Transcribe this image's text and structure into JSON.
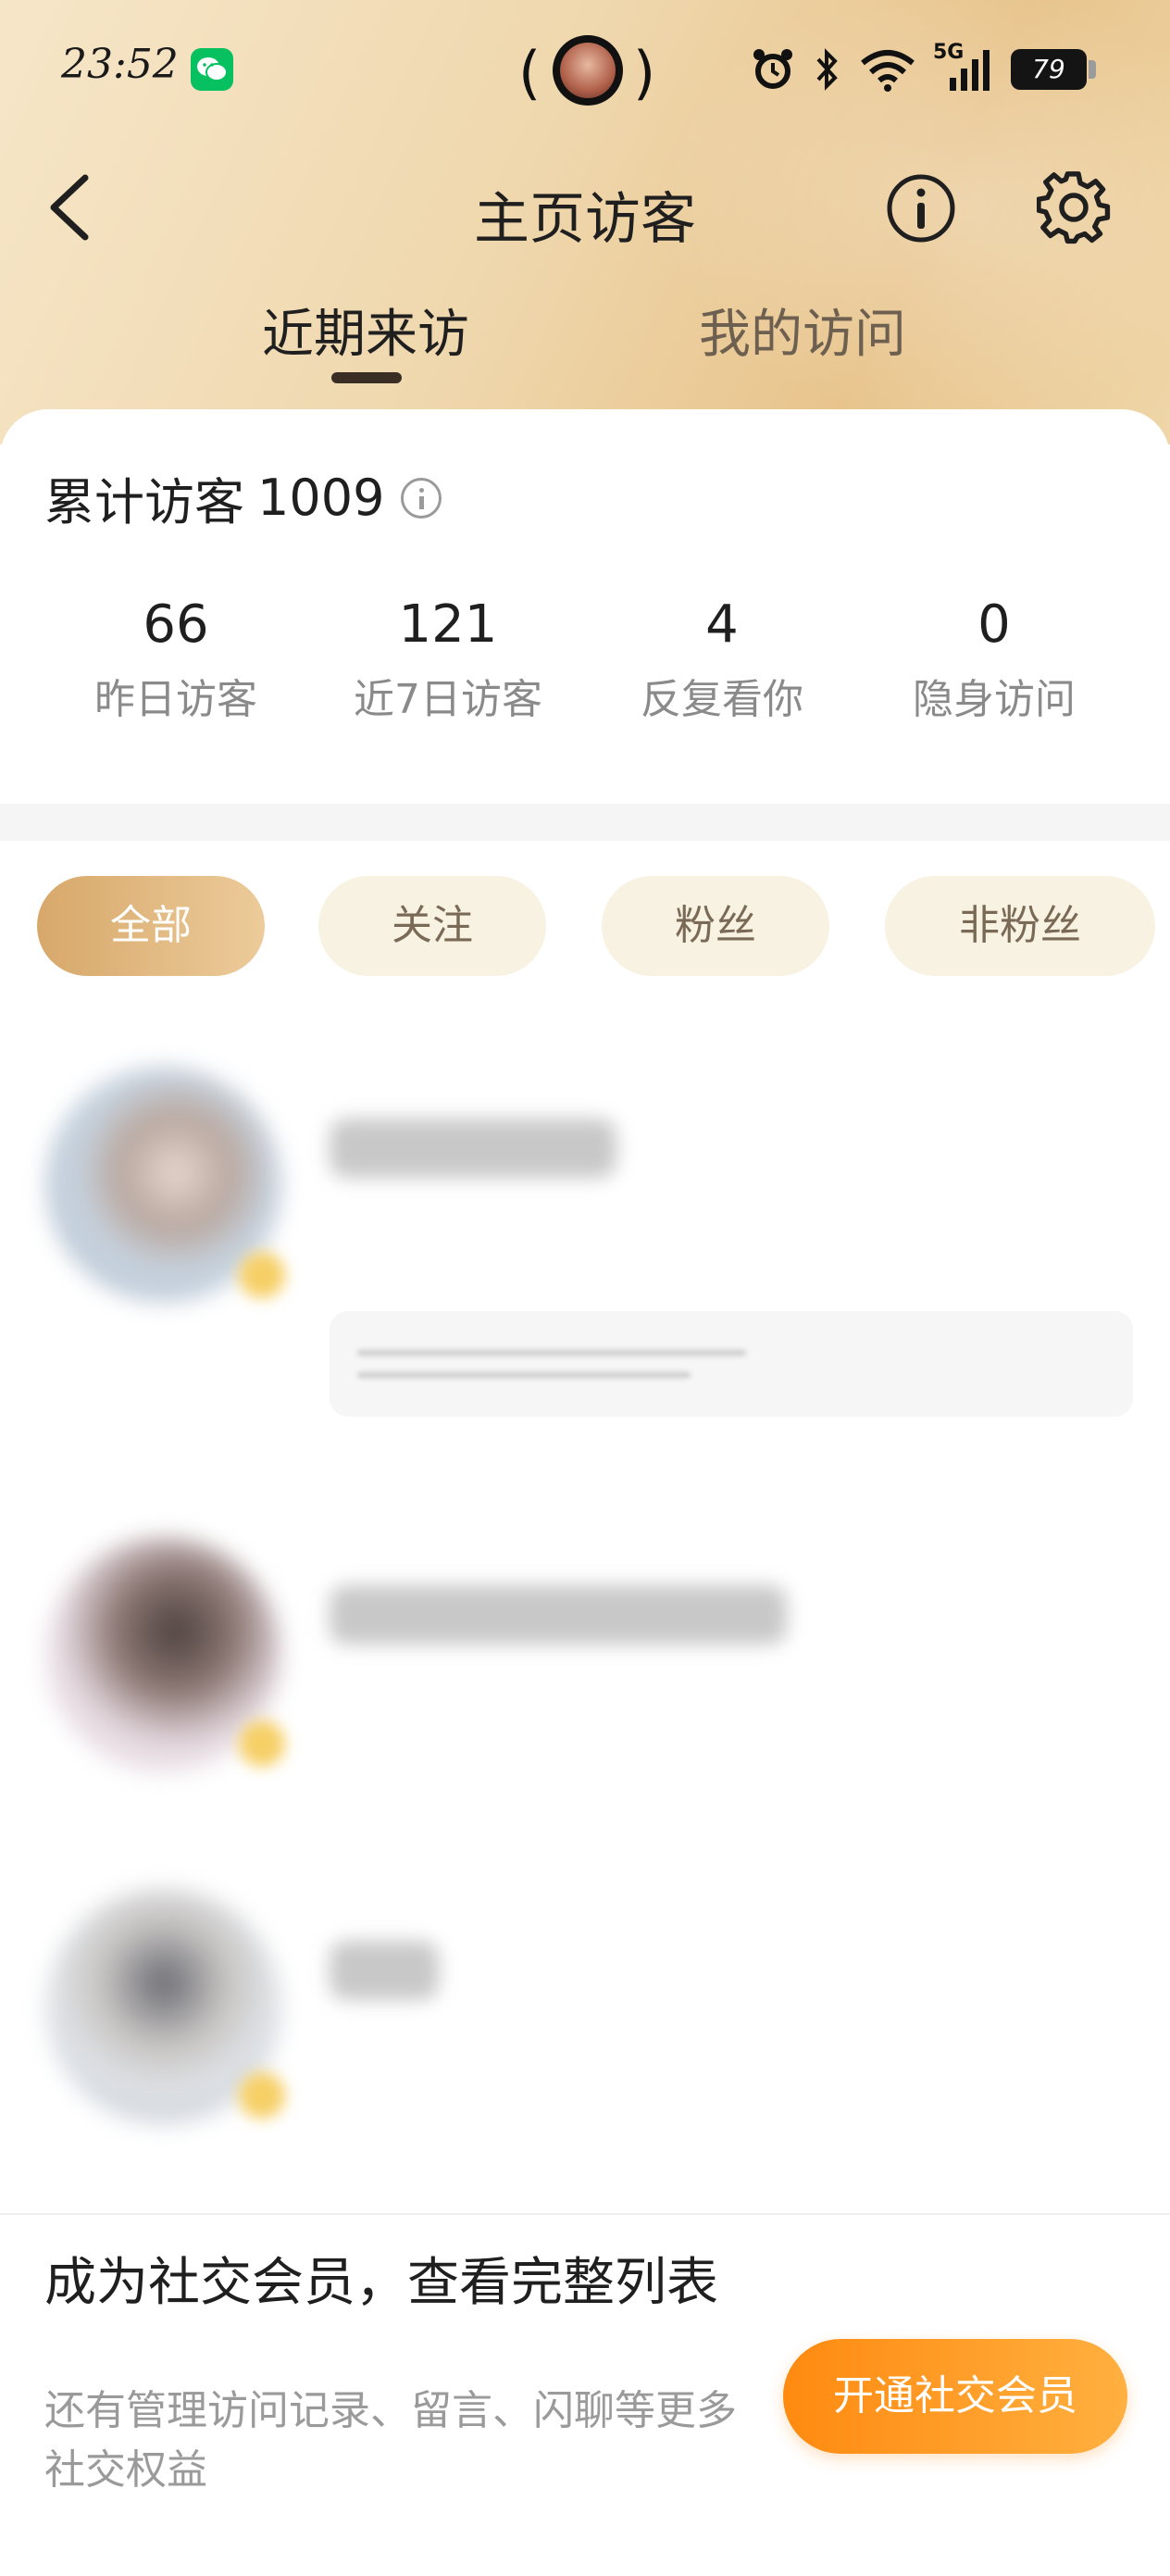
{
  "status_bar": {
    "time": "23:52",
    "network": "5G",
    "battery": "79"
  },
  "nav": {
    "title": "主页访客"
  },
  "tabs": [
    {
      "label": "近期来访"
    },
    {
      "label": "我的访问"
    }
  ],
  "summary": {
    "label": "累计访客",
    "value": "1009"
  },
  "stats": [
    {
      "value": "66",
      "label": "昨日访客"
    },
    {
      "value": "121",
      "label": "近7日访客"
    },
    {
      "value": "4",
      "label": "反复看你"
    },
    {
      "value": "0",
      "label": "隐身访问"
    }
  ],
  "filters": [
    {
      "label": "全部"
    },
    {
      "label": "关注"
    },
    {
      "label": "粉丝"
    },
    {
      "label": "非粉丝"
    }
  ],
  "colors": {
    "accent_gold": "#d7a86a",
    "cta_orange": "#ff8a10",
    "chip_bg": "#f8f2e2"
  },
  "promo": {
    "title": "成为社交会员，查看完整列表",
    "desc": "还有管理访问记录、留言、闪聊等更多社交权益",
    "button": "开通社交会员"
  }
}
